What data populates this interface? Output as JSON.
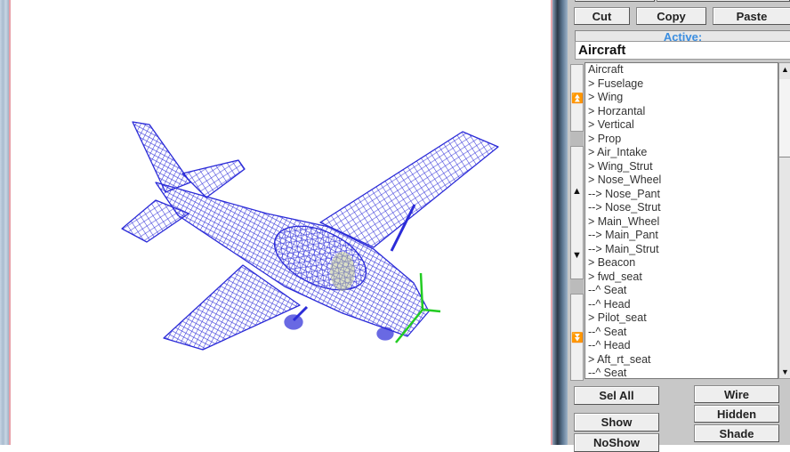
{
  "toolbar": {
    "cut": "Cut",
    "copy": "Copy",
    "paste": "Paste"
  },
  "active": {
    "label": "Active:",
    "value": "Aircraft"
  },
  "components": [
    "Aircraft",
    "> Fuselage",
    "> Wing",
    "> Horzantal",
    "> Vertical",
    "> Prop",
    "> Air_Intake",
    "> Wing_Strut",
    "> Nose_Wheel",
    "--> Nose_Pant",
    "--> Nose_Strut",
    "> Main_Wheel",
    "--> Main_Pant",
    "--> Main_Strut",
    "> Beacon",
    "> fwd_seat",
    "--^ Seat",
    "--^ Head",
    "> Pilot_seat",
    "--^ Seat",
    "--^ Head",
    "> Aft_rt_seat",
    "--^ Seat"
  ],
  "buttons": {
    "sel_all": "Sel All",
    "show": "Show",
    "noshow": "NoShow",
    "wire": "Wire",
    "hidden": "Hidden",
    "shade": "Shade"
  },
  "colors": {
    "wireframe": "#2b2bd8",
    "prop": "#22cc22",
    "accent": "#3b8ee0"
  }
}
